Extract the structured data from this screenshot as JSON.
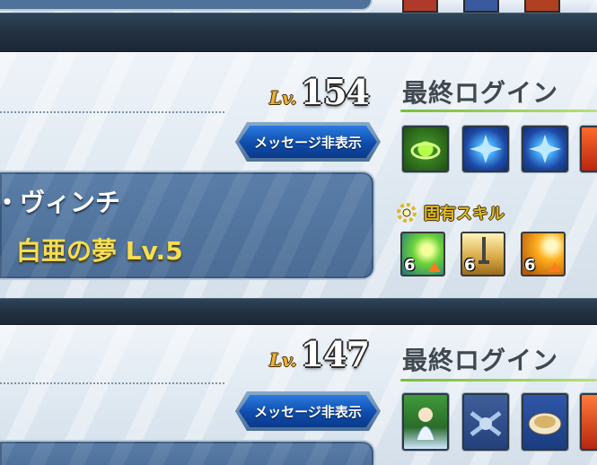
{
  "players": [
    {
      "level_label": "Lv.",
      "level": "154",
      "last_login_label": "最終ログイン",
      "message_button": "メッセージ非表示",
      "name_fragment": "・ヴィンチ",
      "craft_essence": "白亜の夢 Lv.5",
      "unique_skill_label": "固有スキル",
      "skills": [
        {
          "level": "6",
          "icon": "skill-burst-icon"
        },
        {
          "level": "6",
          "icon": "skill-sword-icon"
        },
        {
          "level": "6",
          "icon": "skill-gold-icon"
        }
      ],
      "support_icons": [
        "green-circle-icon",
        "blue-star-icon",
        "blue-star-icon",
        "red-icon"
      ]
    },
    {
      "level_label": "Lv.",
      "level": "147",
      "last_login_label": "最終ログイン",
      "message_button": "メッセージ非表示",
      "support_icons": [
        "green-servant-icon",
        "blue-servant-icon",
        "soup-icon",
        "red-icon"
      ]
    }
  ],
  "colors": {
    "gold": "#e8b23a",
    "blue_button": "#1a5fc8",
    "panel": "#4f729b",
    "title_yellow": "#f6dd52"
  }
}
